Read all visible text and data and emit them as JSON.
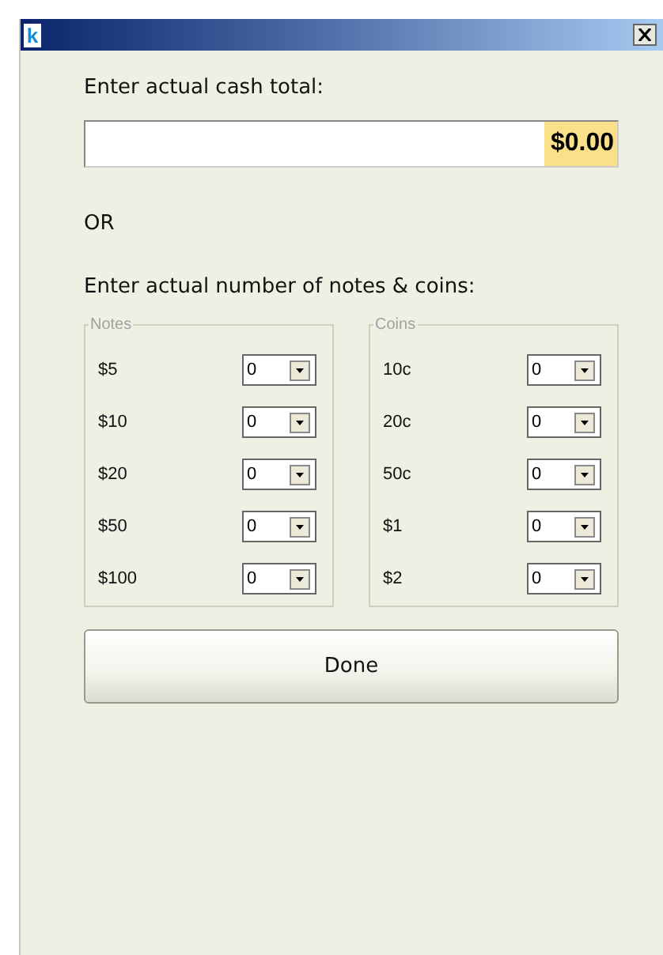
{
  "window": {
    "logo": "k"
  },
  "cash_total": {
    "label": "Enter actual cash total:",
    "value": "$0.00"
  },
  "or_label": "OR",
  "count_label": "Enter actual number of notes & coins:",
  "groups": [
    {
      "legend": "Notes",
      "rows": [
        {
          "label": "$5",
          "value": "0"
        },
        {
          "label": "$10",
          "value": "0"
        },
        {
          "label": "$20",
          "value": "0"
        },
        {
          "label": "$50",
          "value": "0"
        },
        {
          "label": "$100",
          "value": "0"
        }
      ]
    },
    {
      "legend": "Coins",
      "rows": [
        {
          "label": "10c",
          "value": "0"
        },
        {
          "label": "20c",
          "value": "0"
        },
        {
          "label": "50c",
          "value": "0"
        },
        {
          "label": "$1",
          "value": "0"
        },
        {
          "label": "$2",
          "value": "0"
        }
      ]
    }
  ],
  "buttons": [
    "Done"
  ]
}
